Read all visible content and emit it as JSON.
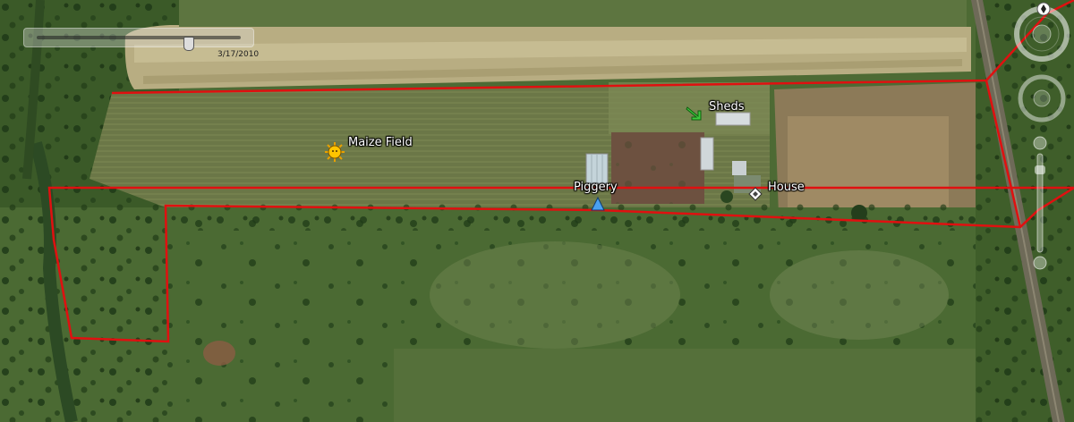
{
  "time_slider": {
    "date": "3/17/2010",
    "position": 0.75
  },
  "placemarks": {
    "maize_field": {
      "label": "Maize Field",
      "icon": "sun-icon"
    },
    "sheds": {
      "label": "Sheds",
      "icon": "green-arrow-icon"
    },
    "piggery": {
      "label": "Piggery",
      "icon": "blue-triangle-icon"
    },
    "house": {
      "label": "House",
      "icon": "diamond-icon"
    }
  },
  "boundary": {
    "color": "#e01010"
  },
  "navigation": {
    "icons": [
      "north-compass-icon",
      "look-joystick-icon",
      "move-joystick-icon",
      "zoom-slider-icon"
    ]
  }
}
